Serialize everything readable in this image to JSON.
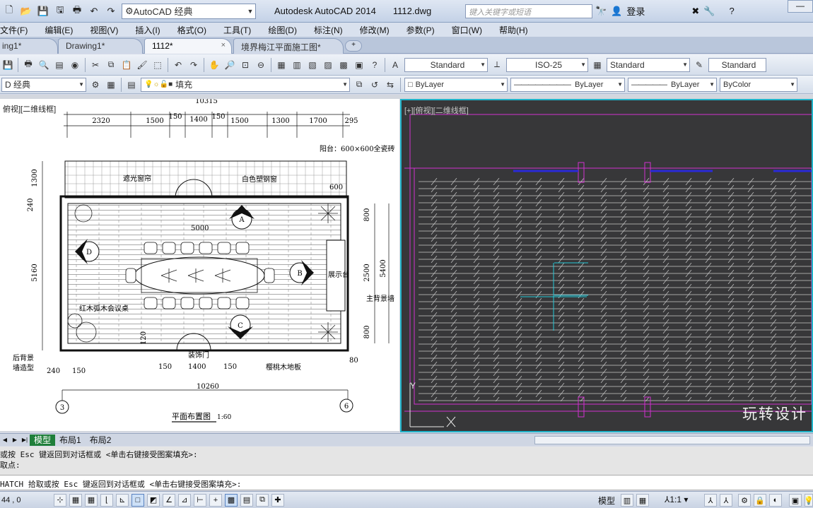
{
  "titlebar": {
    "workspace": "AutoCAD 经典",
    "app_title": "Autodesk AutoCAD 2014",
    "file_name": "1112.dwg",
    "search_placeholder": "键入关键字或短语",
    "login": "登录",
    "help": "?"
  },
  "menu": [
    "文件(F)",
    "编辑(E)",
    "视图(V)",
    "插入(I)",
    "格式(O)",
    "工具(T)",
    "绘图(D)",
    "标注(N)",
    "修改(M)",
    "参数(P)",
    "窗口(W)",
    "帮助(H)"
  ],
  "tabs": [
    {
      "label": "ing1*"
    },
    {
      "label": "Drawing1*"
    },
    {
      "label": "1112*",
      "close": "×"
    },
    {
      "label": "境界梅江平面施工图*"
    }
  ],
  "toolbar1": {
    "text_style": "Standard",
    "dim_style": "ISO-25",
    "table_style": "Standard",
    "mleader_style": "Standard"
  },
  "toolbar2": {
    "workspace": "D 经典",
    "layer": "填充",
    "color": "ByLayer",
    "linetype": "ByLayer",
    "lineweight": "ByLayer",
    "plotstyle": "ByColor"
  },
  "viewport_left": {
    "label": "俯视][二维线框]",
    "dims_top": [
      "2320",
      "1500",
      "150",
      "1400",
      "150",
      "1500",
      "1300",
      "1700",
      "295"
    ],
    "dim_overall_top": "10315",
    "dims_left": [
      "1300",
      "240",
      "5160"
    ],
    "dims_right": [
      "800",
      "2500",
      "5400",
      "800"
    ],
    "labels": {
      "balcony": "阳台：600×600全瓷砖",
      "curtain": "遮光窗帘",
      "window": "白色塑钢窗",
      "d600": "600",
      "d5000": "5000",
      "display": "展示台",
      "main_wall": "主背景墙",
      "table": "红木弧木会议桌",
      "back_wall": "后背景",
      "back_wall2": "墙造型",
      "door": "装饰门",
      "floor": "樱桃木地板",
      "d120": "120",
      "d80": "80",
      "bottom_dims": [
        "240",
        "150",
        "150",
        "1400",
        "150"
      ],
      "overall_bottom": "10260",
      "title": "平面布置图",
      "scale": "1:60",
      "axis_left": "3",
      "axis_right": "6",
      "markers": [
        "A",
        "B",
        "C",
        "D"
      ]
    }
  },
  "viewport_right": {
    "label": "[+][俯视][二维线框]",
    "watermark": "玩转设计",
    "ucs_y": "Y"
  },
  "layout_tabs": [
    "模型",
    "布局1",
    "布局2"
  ],
  "command": {
    "history1": "或按 Esc 键返回到对话框或 <单击右键接受图案填充>:",
    "history2": "取点:",
    "current": "HATCH 拾取或按 Esc 键返回到对话框或 <单击右键接受图案填充>:"
  },
  "status": {
    "coords": "44 , 0",
    "model": "模型",
    "scale": "1:1"
  }
}
